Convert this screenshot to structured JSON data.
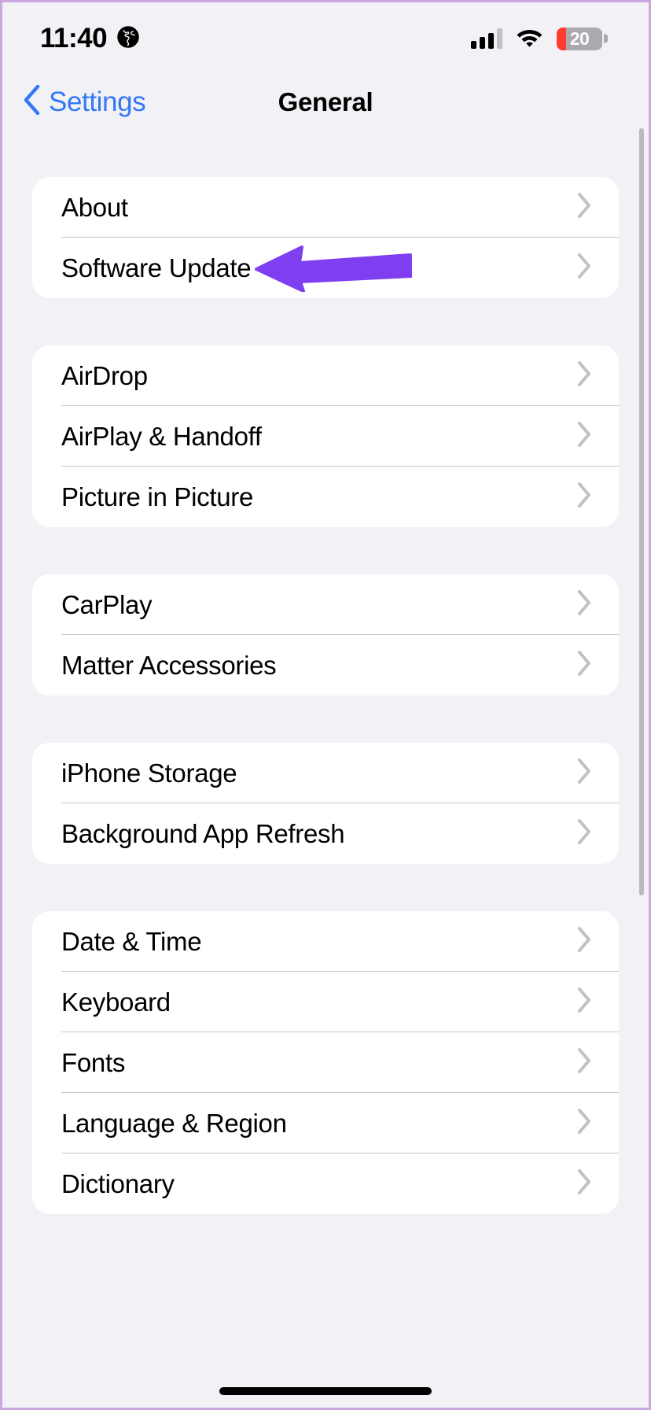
{
  "status_bar": {
    "time": "11:40",
    "location_icon": "globe-icon",
    "cellular_icon": "signal-bars-icon",
    "wifi_icon": "wifi-icon",
    "battery_level": "20",
    "battery_percent": 20,
    "battery_color": "#FF3B30",
    "battery_body_color": "#A9A9AE"
  },
  "nav": {
    "back_label": "Settings",
    "back_icon": "chevron-left-icon",
    "title": "General",
    "accent_color": "#3478F6"
  },
  "annotation": {
    "type": "arrow",
    "direction": "left",
    "color": "#7F3FF0",
    "points_to": "Software Update"
  },
  "groups": [
    {
      "id": "group-about",
      "rows": [
        {
          "label": "About",
          "chevron": "chevron-right-icon"
        },
        {
          "label": "Software Update",
          "chevron": "chevron-right-icon"
        }
      ]
    },
    {
      "id": "group-sharing",
      "rows": [
        {
          "label": "AirDrop",
          "chevron": "chevron-right-icon"
        },
        {
          "label": "AirPlay & Handoff",
          "chevron": "chevron-right-icon"
        },
        {
          "label": "Picture in Picture",
          "chevron": "chevron-right-icon"
        }
      ]
    },
    {
      "id": "group-accessories",
      "rows": [
        {
          "label": "CarPlay",
          "chevron": "chevron-right-icon"
        },
        {
          "label": "Matter Accessories",
          "chevron": "chevron-right-icon"
        }
      ]
    },
    {
      "id": "group-storage",
      "rows": [
        {
          "label": "iPhone Storage",
          "chevron": "chevron-right-icon"
        },
        {
          "label": "Background App Refresh",
          "chevron": "chevron-right-icon"
        }
      ]
    },
    {
      "id": "group-system",
      "rows": [
        {
          "label": "Date & Time",
          "chevron": "chevron-right-icon"
        },
        {
          "label": "Keyboard",
          "chevron": "chevron-right-icon"
        },
        {
          "label": "Fonts",
          "chevron": "chevron-right-icon"
        },
        {
          "label": "Language & Region",
          "chevron": "chevron-right-icon"
        },
        {
          "label": "Dictionary",
          "chevron": "chevron-right-icon"
        }
      ]
    }
  ]
}
